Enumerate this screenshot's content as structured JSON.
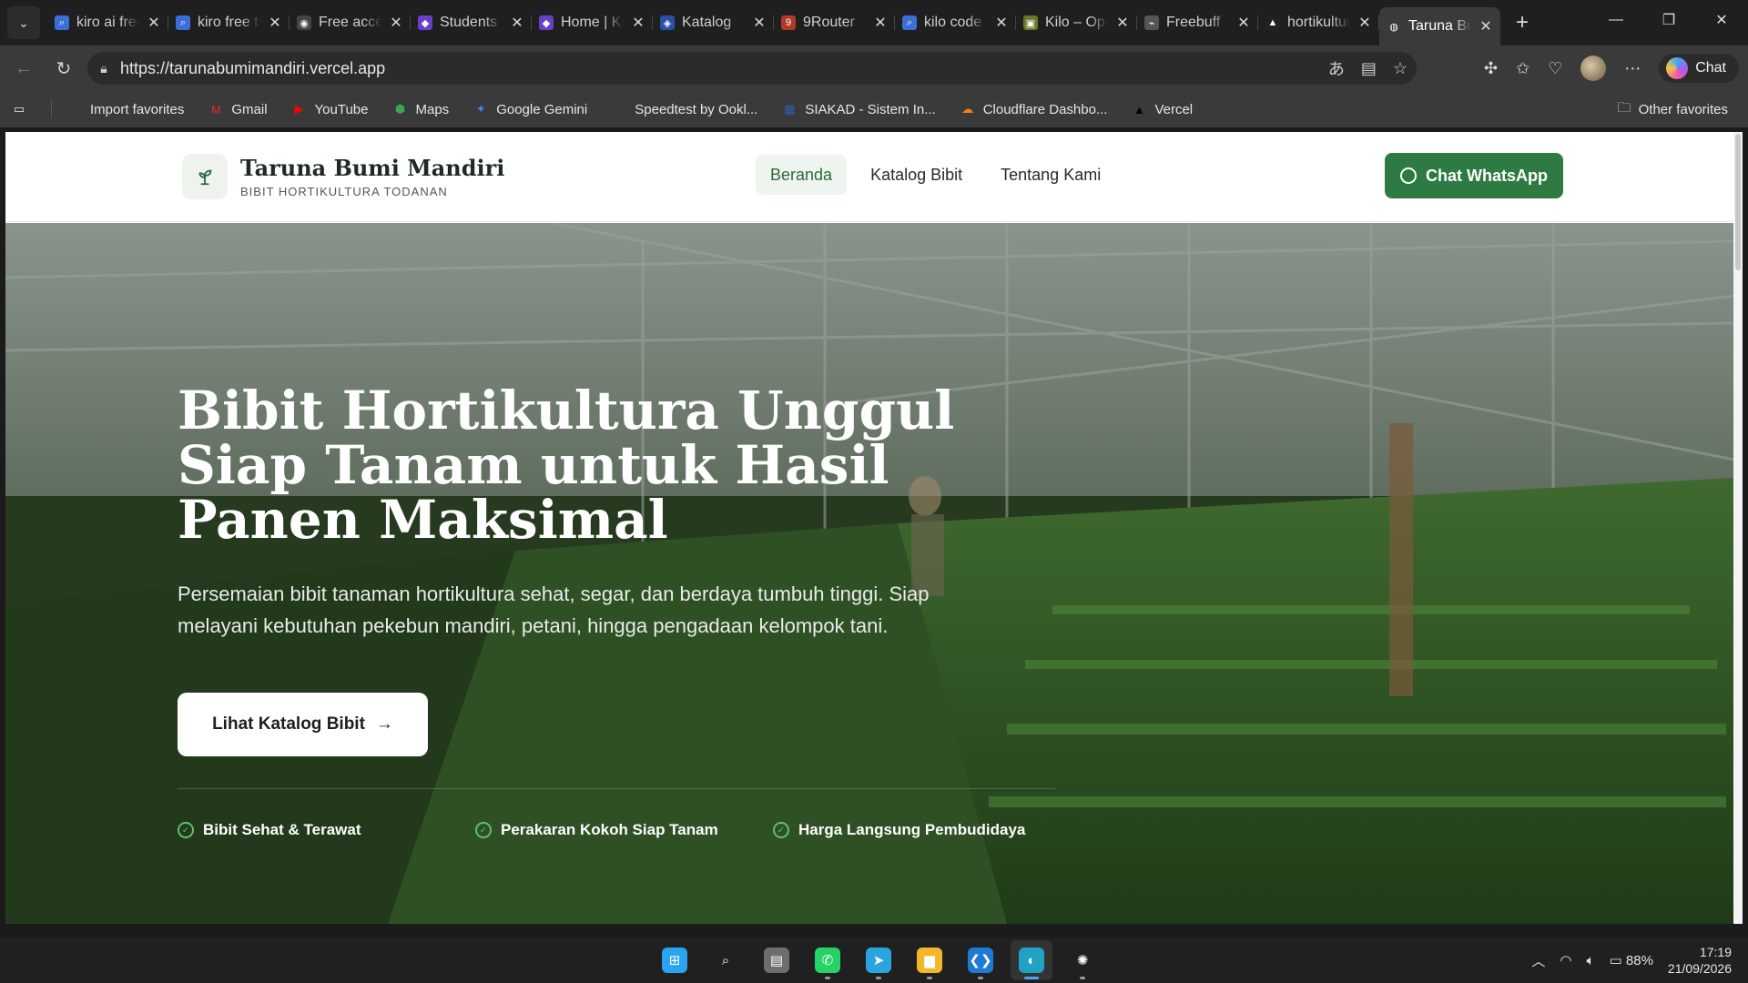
{
  "browser": {
    "tabs": [
      {
        "title": "kiro ai free",
        "icon": "search-icon",
        "color": "#3b6fd8",
        "glyph": "⌕"
      },
      {
        "title": "kiro free tier",
        "icon": "search-icon",
        "color": "#3b6fd8",
        "glyph": "⌕"
      },
      {
        "title": "Free access",
        "icon": "github-icon",
        "color": "#444444",
        "glyph": "◉"
      },
      {
        "title": "Students",
        "icon": "app-icon",
        "color": "#6a3fc8",
        "glyph": "◆"
      },
      {
        "title": "Home | Kilo",
        "icon": "app-icon",
        "color": "#6a3fc8",
        "glyph": "◆"
      },
      {
        "title": "Katalog",
        "icon": "app-icon",
        "color": "#2a4fa8",
        "glyph": "◈"
      },
      {
        "title": "9Router",
        "icon": "app-icon",
        "color": "#b33a2a",
        "glyph": "9"
      },
      {
        "title": "kilo code",
        "icon": "search-icon",
        "color": "#3b6fd8",
        "glyph": "⌕"
      },
      {
        "title": "Kilo – Open",
        "icon": "app-icon",
        "color": "#6a7a2a",
        "glyph": "▣"
      },
      {
        "title": "Freebuff",
        "icon": "app-icon",
        "color": "#555555",
        "glyph": "⌁"
      },
      {
        "title": "hortikultura",
        "icon": "vercel-icon",
        "color": "#222222",
        "glyph": "▲"
      },
      {
        "title": "Taruna Bumi",
        "icon": "globe-icon",
        "color": "#3a3a3a",
        "glyph": "◍",
        "active": true
      }
    ],
    "url": "https://tarunabumimandiri.vercel.app",
    "copilot_label": "Chat",
    "bookmarks": [
      {
        "label": "Import favorites",
        "icon": "import-icon",
        "glyph": "⇲",
        "color": "#3a3a3a"
      },
      {
        "label": "Gmail",
        "icon": "gmail-icon",
        "glyph": "M",
        "color": "#d93025"
      },
      {
        "label": "YouTube",
        "icon": "youtube-icon",
        "glyph": "▶",
        "color": "#ff0000"
      },
      {
        "label": "Maps",
        "icon": "maps-icon",
        "glyph": "⬢",
        "color": "#34a853"
      },
      {
        "label": "Google Gemini",
        "icon": "gemini-icon",
        "glyph": "✦",
        "color": "#4f7df3"
      },
      {
        "label": "Speedtest by Ookl...",
        "icon": "speedtest-icon",
        "glyph": "◔",
        "color": "#3a3a3a"
      },
      {
        "label": "SIAKAD - Sistem In...",
        "icon": "siakad-icon",
        "glyph": "▦",
        "color": "#2b5fb4"
      },
      {
        "label": "Cloudflare Dashbo...",
        "icon": "cloudflare-icon",
        "glyph": "☁",
        "color": "#f48120"
      },
      {
        "label": "Vercel",
        "icon": "vercel-icon",
        "glyph": "▲",
        "color": "#000000"
      }
    ],
    "other_favorites": "Other favorites"
  },
  "site": {
    "brand_name": "Taruna Bumi Mandiri",
    "brand_tagline": "BIBIT HORTIKULTURA TODANAN",
    "nav": [
      {
        "label": "Beranda",
        "active": true
      },
      {
        "label": "Katalog Bibit"
      },
      {
        "label": "Tentang Kami"
      }
    ],
    "cta_whatsapp": "Chat WhatsApp",
    "hero": {
      "title": "Bibit Hortikultura Unggul Siap Tanam untuk Hasil Panen Maksimal",
      "subtitle": "Persemaian bibit tanaman hortikultura sehat, segar, dan berdaya tumbuh tinggi. Siap melayani kebutuhan pekebun mandiri, petani, hingga pengadaan kelompok tani.",
      "cta": "Lihat Katalog Bibit",
      "features": [
        "Bibit Sehat & Terawat",
        "Perakaran Kokoh Siap Tanam",
        "Harga Langsung Pembudidaya"
      ]
    },
    "accent_color": "#2d7a43"
  },
  "taskbar": {
    "apps": [
      {
        "name": "start-button",
        "glyph": "⊞",
        "color": "#2aa3f0"
      },
      {
        "name": "search-taskbar-button",
        "glyph": "⌕",
        "color": "#202020"
      },
      {
        "name": "task-view-button",
        "glyph": "▤",
        "color": "#6d6d6d"
      },
      {
        "name": "whatsapp-app",
        "glyph": "✆",
        "color": "#25d366"
      },
      {
        "name": "telegram-app",
        "glyph": "➤",
        "color": "#2aa3df"
      },
      {
        "name": "file-explorer-app",
        "glyph": "▆",
        "color": "#f2b829"
      },
      {
        "name": "vscode-app",
        "glyph": "❮❯",
        "color": "#1f7ad4"
      },
      {
        "name": "edge-app",
        "glyph": "◐",
        "color": "#1fa2c4",
        "active": true
      },
      {
        "name": "chatgpt-app",
        "glyph": "✺",
        "color": "#202020"
      }
    ],
    "battery": "88%",
    "time": "17:19",
    "date": "21/09/2026"
  }
}
